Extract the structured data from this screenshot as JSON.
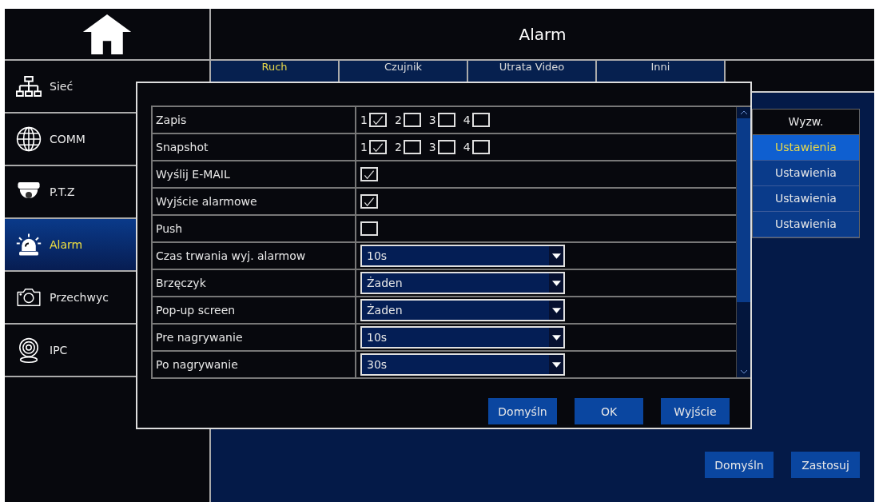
{
  "header": {
    "title": "Alarm"
  },
  "sidebar": {
    "items": [
      {
        "label": "Sieć",
        "kind": "network",
        "selected": false
      },
      {
        "label": "COMM",
        "kind": "globe",
        "selected": false
      },
      {
        "label": "P.T.Z",
        "kind": "dome",
        "selected": false
      },
      {
        "label": "Alarm",
        "kind": "siren",
        "selected": true
      },
      {
        "label": "Przechwyc",
        "kind": "camera",
        "selected": false
      },
      {
        "label": "IPC",
        "kind": "webcam",
        "selected": false
      }
    ]
  },
  "tabs": [
    {
      "label": "Ruch",
      "selected": true
    },
    {
      "label": "Czujnik",
      "selected": false
    },
    {
      "label": "Utrata Video",
      "selected": false
    },
    {
      "label": "Inni",
      "selected": false
    }
  ],
  "trigger_table": {
    "header": "Wyzw.",
    "rows": [
      {
        "label": "Ustawienia",
        "selected": true
      },
      {
        "label": "Ustawienia",
        "selected": false
      },
      {
        "label": "Ustawienia",
        "selected": false
      },
      {
        "label": "Ustawienia",
        "selected": false
      }
    ]
  },
  "dialog": {
    "rows": [
      {
        "label": "Zapis",
        "kind": "channels",
        "channels": [
          {
            "number": "1",
            "checked": true
          },
          {
            "number": "2",
            "checked": false
          },
          {
            "number": "3",
            "checked": false
          },
          {
            "number": "4",
            "checked": false
          }
        ]
      },
      {
        "label": "Snapshot",
        "kind": "channels",
        "channels": [
          {
            "number": "1",
            "checked": true
          },
          {
            "number": "2",
            "checked": false
          },
          {
            "number": "3",
            "checked": false
          },
          {
            "number": "4",
            "checked": false
          }
        ]
      },
      {
        "label": "Wyślij E-MAIL",
        "kind": "checkbox",
        "checked": true
      },
      {
        "label": "Wyjście alarmowe",
        "kind": "checkbox",
        "checked": true
      },
      {
        "label": "Push",
        "kind": "checkbox",
        "checked": false
      },
      {
        "label": "Czas trwania wyj. alarmow",
        "kind": "select",
        "value": "10s"
      },
      {
        "label": "Brzęczyk",
        "kind": "select",
        "value": "Żaden"
      },
      {
        "label": "Pop-up screen",
        "kind": "select",
        "value": "Żaden"
      },
      {
        "label": "Pre nagrywanie",
        "kind": "select",
        "value": "10s"
      },
      {
        "label": "Po nagrywanie",
        "kind": "select",
        "value": "30s"
      }
    ],
    "buttons": [
      "Domyśln",
      "OK",
      "Wyjście"
    ]
  },
  "footer_buttons": [
    "Domyśln",
    "Zastosuj"
  ]
}
